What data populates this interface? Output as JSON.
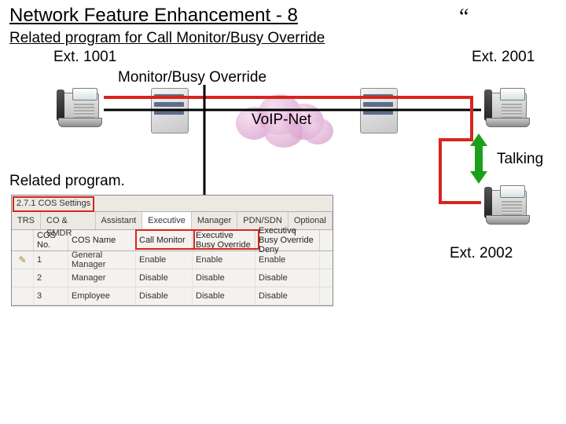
{
  "title": "Network Feature Enhancement - 8",
  "subtitle": "Related program for Call Monitor/Busy Override",
  "quote_mark": "“",
  "phones": {
    "ext_1001": "Ext. 1001",
    "ext_2001": "Ext. 2001",
    "ext_2002": "Ext. 2002"
  },
  "action_label": "Monitor/Busy Override",
  "cloud_label": "VoIP-Net",
  "talking_label": "Talking",
  "related_program_label": "Related program.",
  "cos_section_title": "2.7.1 COS Settings",
  "tabs": [
    "TRS",
    "CO & SMDR",
    "Assistant",
    "Executive",
    "Manager",
    "PDN/SDN",
    "Optional I"
  ],
  "selected_tab_index": 3,
  "table": {
    "headers": [
      "",
      "COS No.",
      "COS Name",
      "Call Monitor",
      "Executive Busy Override",
      "Executive Busy Override Deny"
    ],
    "rows": [
      {
        "pen": true,
        "no": "1",
        "name": "General Manager",
        "call_monitor": "Enable",
        "override": "Enable",
        "override_deny": "Enable"
      },
      {
        "pen": false,
        "no": "2",
        "name": "Manager",
        "call_monitor": "Disable",
        "override": "Disable",
        "override_deny": "Disable"
      },
      {
        "pen": false,
        "no": "3",
        "name": "Employee",
        "call_monitor": "Disable",
        "override": "Disable",
        "override_deny": "Disable"
      }
    ]
  },
  "highlight_boxes": [
    "section-title",
    "call-monitor-header",
    "executive-busy-override-header"
  ]
}
